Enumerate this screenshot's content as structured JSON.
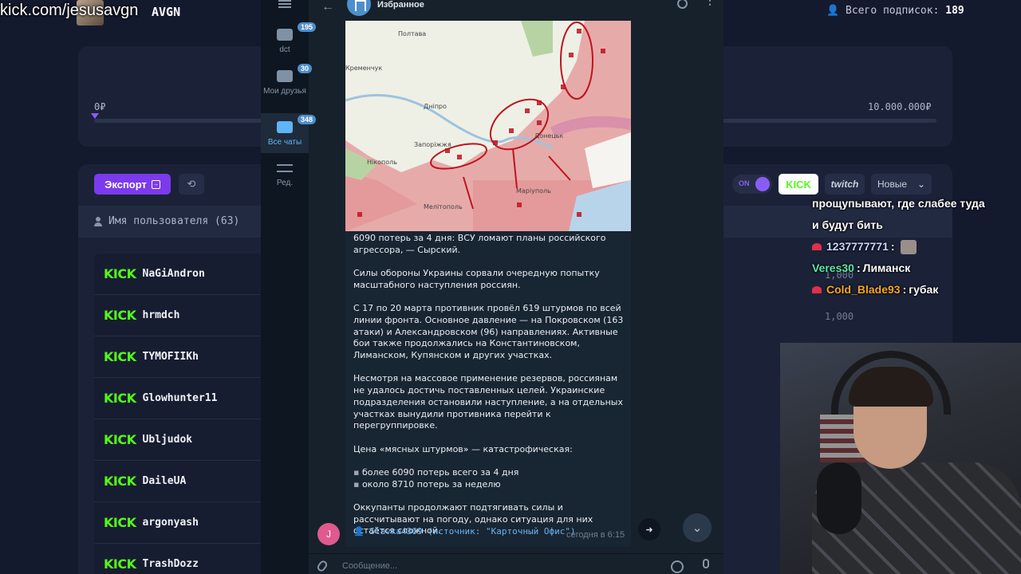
{
  "overlay": {
    "kick_url": "kick.com/jesusavgn",
    "streamer": "AVGN",
    "total_subs_label": "Всего подписок:",
    "total_subs_value": "189"
  },
  "dashboard": {
    "goal_min": "0₽",
    "goal_max": "10.000.000₽",
    "export_label": "Экспорт",
    "users_header": "Имя пользователя (63)",
    "toggle_on": "ON",
    "kick_chip": "KICK",
    "twitch_chip": "twitch",
    "sort_label": "Новые",
    "amounts": [
      "1,000",
      "1,000"
    ],
    "users": [
      {
        "platform": "KICK",
        "name": "NaGiAndron"
      },
      {
        "platform": "KICK",
        "name": "hrmdch"
      },
      {
        "platform": "KICK",
        "name": "TYMOFIIKh"
      },
      {
        "platform": "KICK",
        "name": "Glowhunter11"
      },
      {
        "platform": "KICK",
        "name": "Ubljudok"
      },
      {
        "platform": "KICK",
        "name": "DaileUA"
      },
      {
        "platform": "KICK",
        "name": "argonyash"
      },
      {
        "platform": "KICK",
        "name": "TrashDozz"
      }
    ]
  },
  "chat": {
    "lines": [
      {
        "user": "",
        "text": "прощупывают, где слабее туда"
      },
      {
        "user": "",
        "text": "и будут бить"
      },
      {
        "user": "1237777771",
        "sep": " :",
        "text": "",
        "color": "#c9d6ff"
      },
      {
        "user": "Veres30",
        "sep": " : ",
        "text": "Лиманск",
        "color": "#5ee6a8"
      },
      {
        "user": "Cold_Blade93",
        "sep": " : ",
        "text": "губак",
        "color": "#f5a623"
      }
    ]
  },
  "telegram": {
    "folders": [
      {
        "label": "dct",
        "badge": "195"
      },
      {
        "label": "Мои друзья",
        "badge": "30"
      },
      {
        "label": "Все чаты",
        "badge": "348"
      },
      {
        "label": "Ред.",
        "badge": ""
      }
    ],
    "chat_title": "Избранное",
    "map_labels": [
      "Полтава",
      "Кременчук",
      "Дніпро",
      "Запоріжжя",
      "Нікополь",
      "Донецьк",
      "Маріуполь",
      "Мелітополь"
    ],
    "message": {
      "headline": "6090 потерь за 4 дня: ВСУ ломают планы российского агрессора, — Сырский.",
      "p1": "Силы обороны Украины сорвали очередную попытку масштабного наступления россиян.",
      "p2": "С 17 по 20 марта противник провёл 619 штурмов по всей линии фронта. Основное давление — на Покровском (163 атаки) и Александровском (96) направлениях. Активные бои также продолжались на Константиновском, Лиманском, Купянском и других участках.",
      "p3": "Несмотря на массовое применение резервов, россиянам не удалось достичь поставленных целей. Украинские подразделения остановили наступление, а на отдельных участках вынудили противника перейти к перегруппировке.",
      "p4": "Цена «мясных штурмов» — катастрофическая:",
      "b1": "более 6090 потерь всего за 4 дня",
      "b2": "около 8710 потерь за неделю",
      "p5": "Оккупанты продолжают подтягивать силы и рассчитывают на погоду, однако ситуация для них остаётся сложной.",
      "footer": "Slavka4369 (источник: \"Карточный Офис\")",
      "time": "сегодня в 6:15",
      "sender_initial": "J"
    },
    "input_placeholder": "Сообщение..."
  }
}
